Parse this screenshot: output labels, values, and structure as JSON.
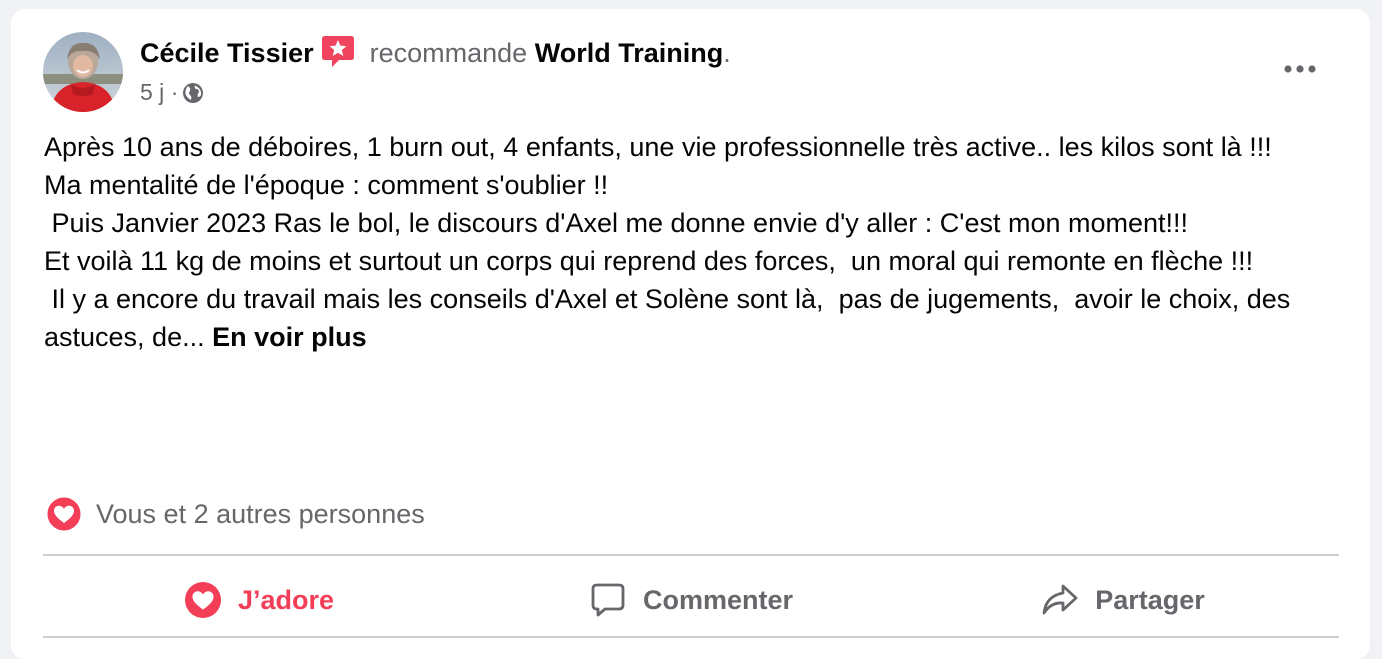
{
  "post": {
    "author": "Cécile Tissier",
    "recommends_text": "recommande",
    "page_name": "World Training",
    "page_suffix": ".",
    "time": "5 j",
    "separator": "·",
    "paragraphs": [
      "Après 10 ans de déboires, 1 burn out, 4 enfants, une vie professionnelle très active.. les kilos sont là !!!",
      "Ma mentalité de l'époque : comment s'oublier !!",
      " Puis Janvier 2023 Ras le bol, le discours d'Axel me donne envie d'y aller : C'est mon moment!!!",
      "Et voilà 11 kg de moins et surtout un corps qui reprend des forces,  un moral qui remonte en flèche !!!",
      " Il y a encore du travail mais les conseils d'Axel et Solène sont là,  pas de jugements,  avoir le choix, des astuces, de... "
    ],
    "see_more": "En voir plus"
  },
  "reactions": {
    "text": "Vous et 2 autres personnes"
  },
  "actions": {
    "love": "J’adore",
    "comment": "Commenter",
    "share": "Partager"
  },
  "icons": {
    "avatar": "profile-photo",
    "recommend": "recommendation-star-badge-icon",
    "audience": "globe-icon",
    "more": "more-options-icon",
    "reaction": "heart-reaction-icon",
    "love": "heart-outline-icon",
    "comment": "comment-bubble-icon",
    "share": "share-arrow-icon"
  },
  "colors": {
    "love": "#f33e58",
    "text": "#050505",
    "secondary": "#65676b",
    "divider": "#ced0d4"
  }
}
